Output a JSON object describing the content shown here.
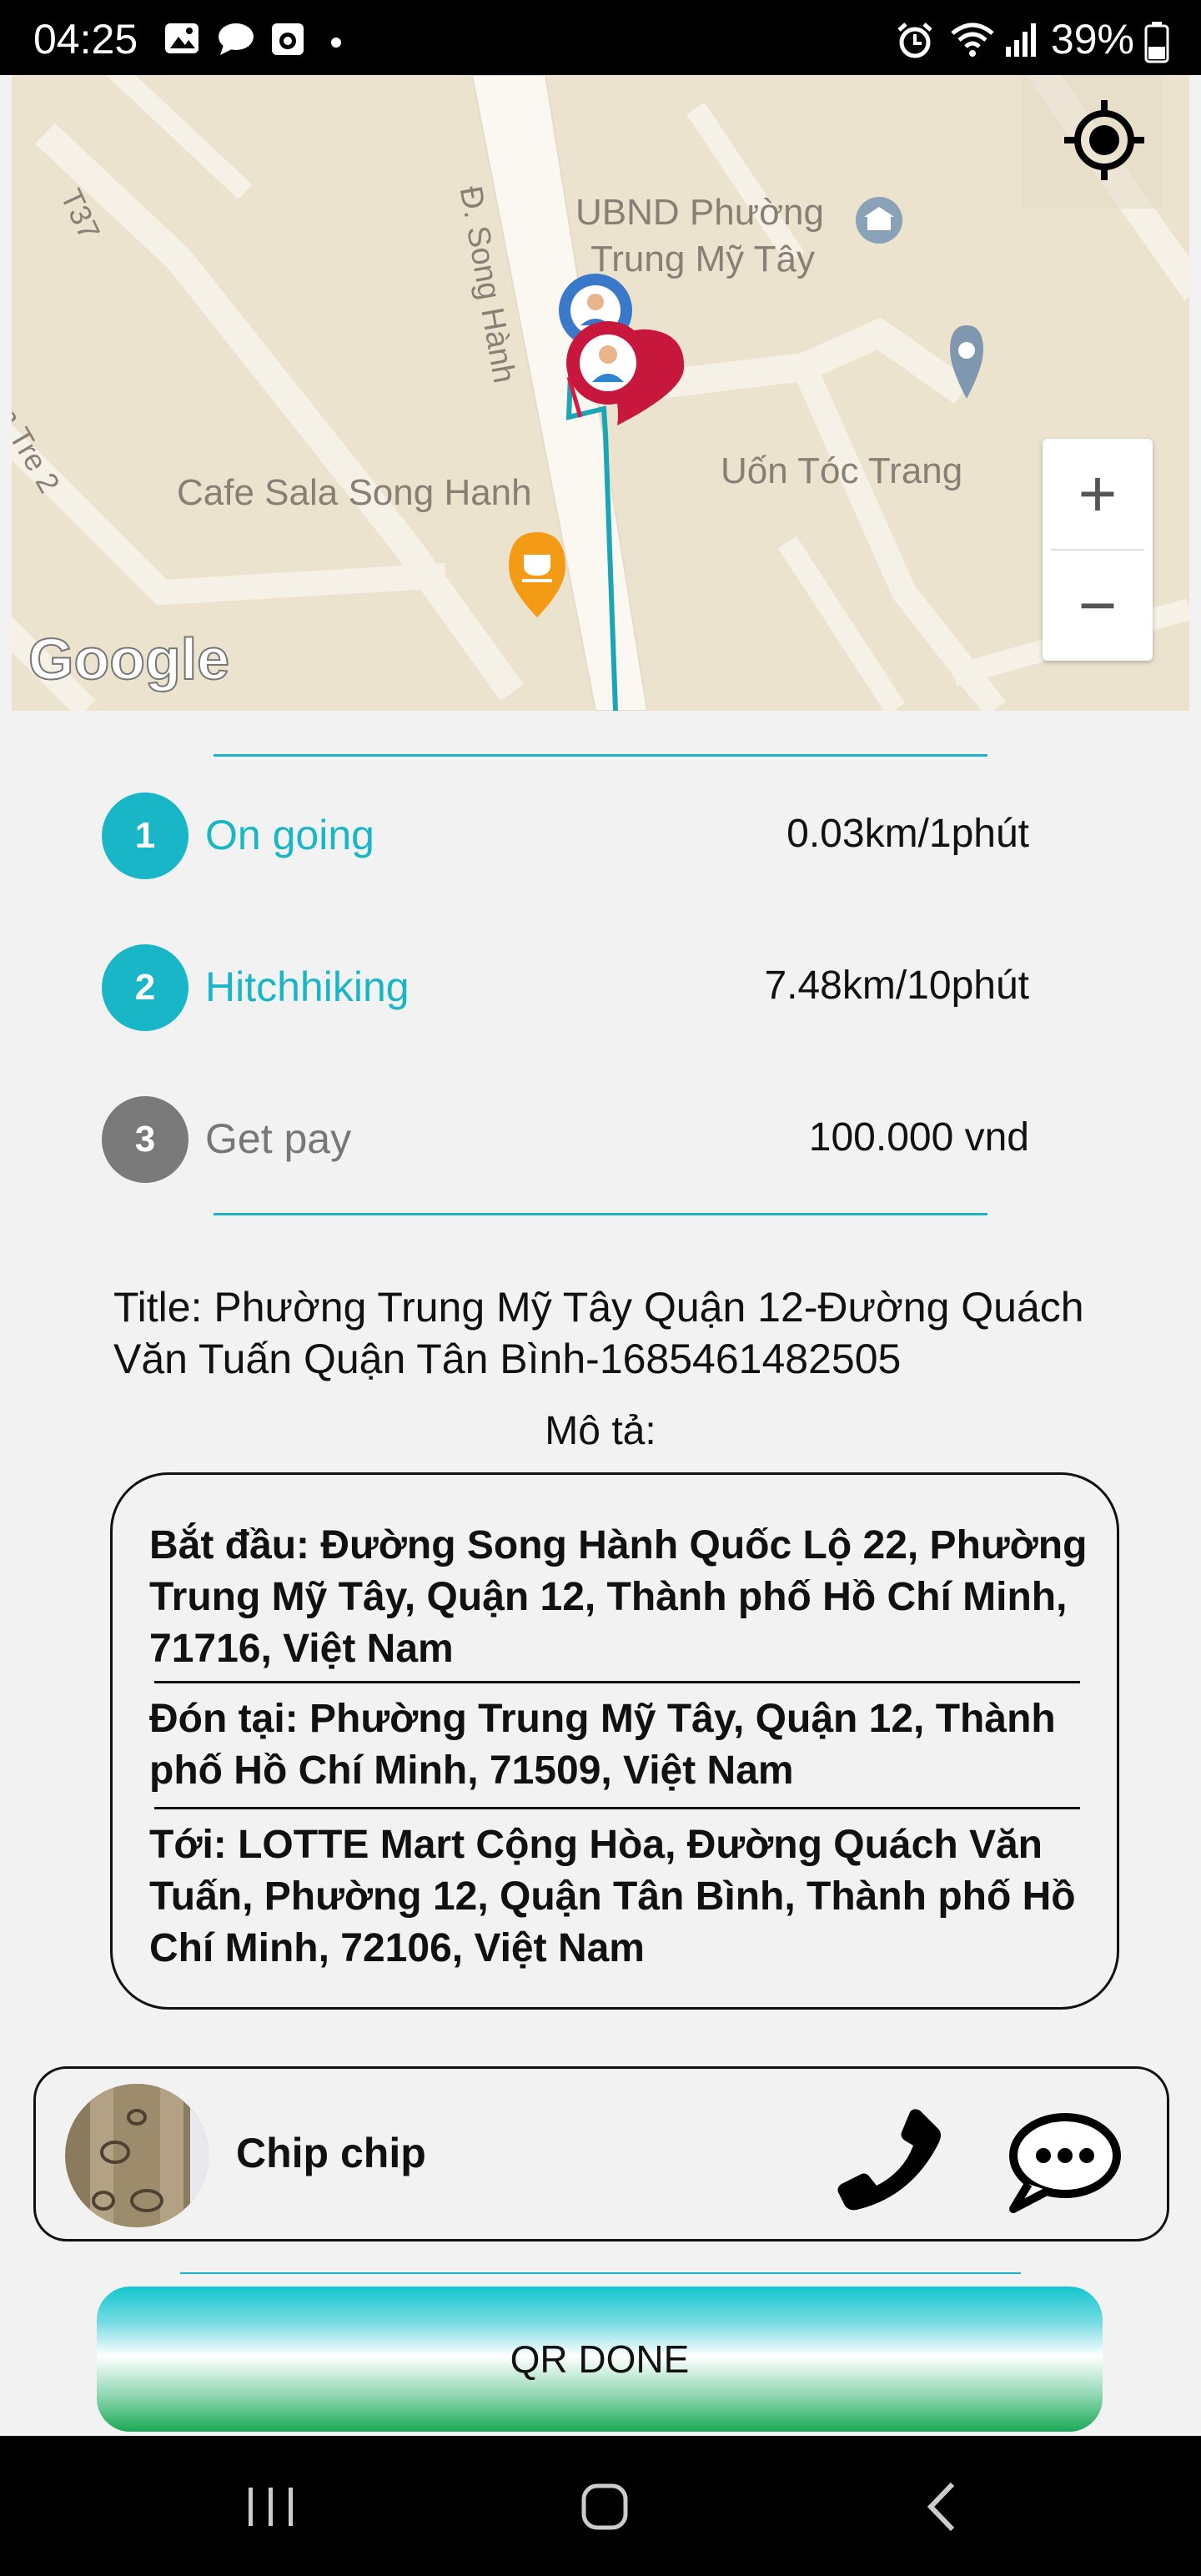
{
  "status_bar": {
    "time": "04:25",
    "battery": "39%",
    "icons": [
      "image-icon",
      "chat-icon",
      "camera-icon",
      "dot-icon",
      "alarm-icon",
      "wifi-icon",
      "signal-icon",
      "battery-icon"
    ]
  },
  "map": {
    "labels": {
      "street": "Đ. Song Hành",
      "t37": "T37",
      "tre2": "n Tre 2",
      "poi_ubnd_line1": "UBND Phường",
      "poi_ubnd_line2": "Trung Mỹ Tây",
      "poi_cafe": "Cafe Sala Song Hanh",
      "poi_salon": "Uốn Tóc Trang"
    },
    "logo": "Google",
    "zoom_in": "+",
    "zoom_out": "−",
    "colors": {
      "route": "#1aa6b5",
      "road": "#fbf8f1",
      "land": "#ece3cf"
    }
  },
  "steps": [
    {
      "number": "1",
      "label": "On going",
      "value": "0.03km/1phút",
      "color": "#19b6c8",
      "text_color": "#19b6c8"
    },
    {
      "number": "2",
      "label": "Hitchhiking",
      "value": "7.48km/10phút",
      "color": "#19b6c8",
      "text_color": "#19b6c8"
    },
    {
      "number": "3",
      "label": "Get pay",
      "value": "100.000 vnd",
      "color": "#7a7a7a",
      "text_color": "#777777"
    }
  ],
  "trip": {
    "title": "Title: Phường Trung Mỹ Tây Quận 12-Đường Quách Văn Tuấn Quận Tân Bình-1685461482505",
    "description_label": "Mô tả:",
    "start": "Bắt đầu: Đường Song Hành Quốc Lộ 22, Phường Trung Mỹ Tây, Quận 12, Thành phố Hồ Chí Minh, 71716, Việt Nam",
    "pickup": "Đón tại: Phường Trung Mỹ Tây, Quận 12, Thành phố Hồ Chí Minh, 71509, Việt Nam",
    "destination": "Tới: LOTTE Mart Cộng Hòa, Đường Quách Văn Tuấn, Phường 12, Quận Tân Bình, Thành phố Hồ Chí Minh, 72106, Việt Nam"
  },
  "driver": {
    "name": "Chip chip"
  },
  "actions": {
    "qr_done": "QR DONE"
  },
  "accent_color": "#1cb3c6"
}
